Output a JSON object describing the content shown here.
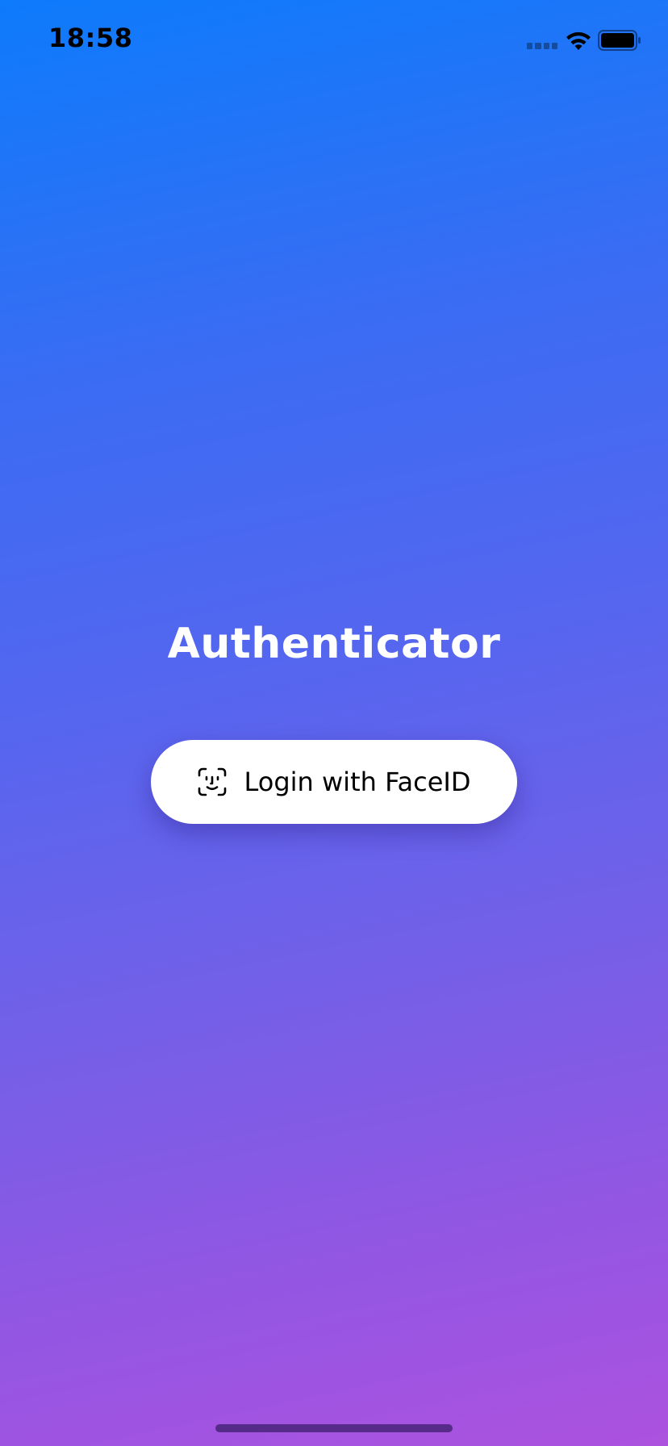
{
  "status_bar": {
    "time": "18:58",
    "icons": [
      "signal-icon",
      "wifi-icon",
      "battery-icon"
    ]
  },
  "main": {
    "title": "Authenticator",
    "login_button": {
      "label": "Login with FaceID",
      "icon": "faceid-icon"
    }
  },
  "colors": {
    "gradient_top": "#0d7bfb",
    "gradient_bottom": "#ac52df",
    "button_background": "#ffffff",
    "title_text": "#ffffff"
  }
}
